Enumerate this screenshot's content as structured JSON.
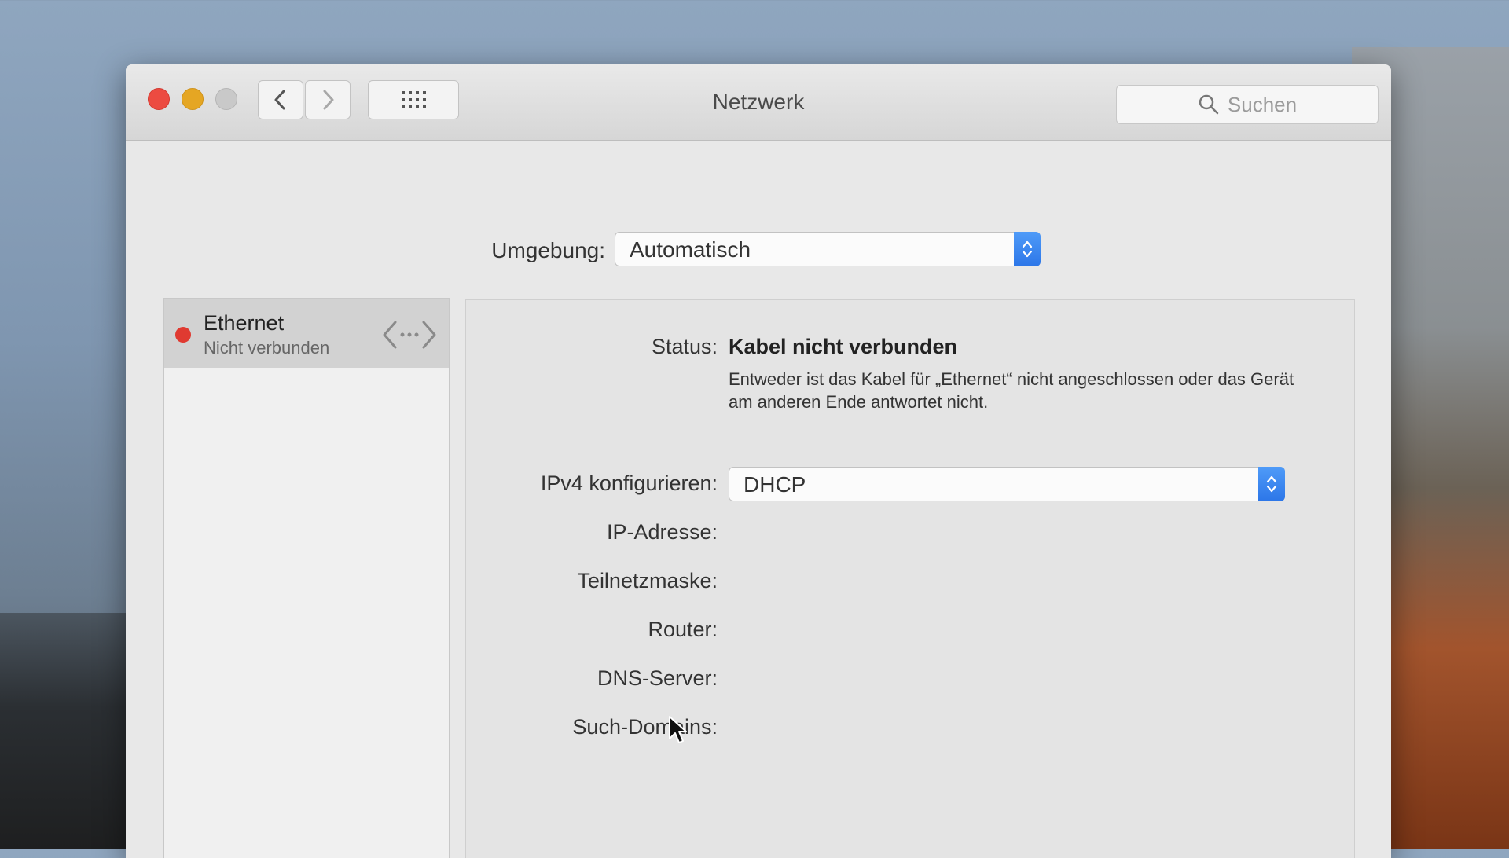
{
  "window": {
    "title": "Netzwerk"
  },
  "toolbar": {
    "search_placeholder": "Suchen"
  },
  "location": {
    "label": "Umgebung:",
    "value": "Automatisch"
  },
  "sidebar": {
    "services": [
      {
        "name": "Ethernet",
        "status": "Nicht verbunden",
        "status_color": "#e03a31",
        "icon": "ethernet-arrows-icon"
      }
    ]
  },
  "detail": {
    "status_label": "Status:",
    "status_value": "Kabel nicht verbunden",
    "status_description": "Entweder ist das Kabel für „Ethernet“ nicht angeschlossen oder das Gerät am anderen Ende antwortet nicht.",
    "ipv4_label": "IPv4 konfigurieren:",
    "ipv4_value": "DHCP",
    "ip_address_label": "IP-Adresse:",
    "subnet_label": "Teilnetzmaske:",
    "router_label": "Router:",
    "dns_label": "DNS-Server:",
    "search_domains_label": "Such-Domains:"
  },
  "colors": {
    "accent": "#2c76e8",
    "close": "#ec4b41",
    "minimize": "#e5a623",
    "zoom": "#c9c9c9"
  }
}
